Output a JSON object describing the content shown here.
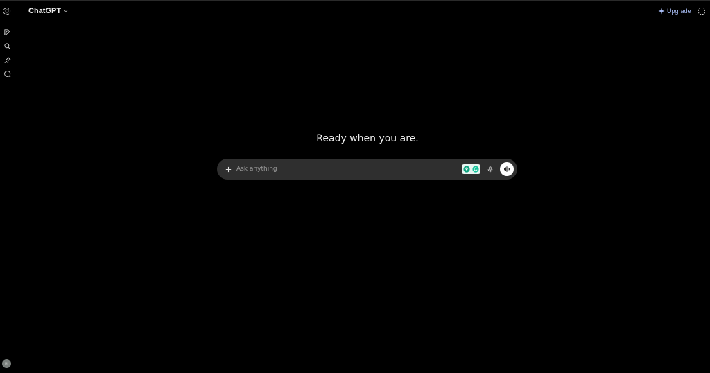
{
  "header": {
    "model_name": "ChatGPT",
    "upgrade_label": "Upgrade"
  },
  "sidebar": {
    "icons": [
      "chatgpt-logo-icon",
      "new-chat-icon",
      "search-icon",
      "pin-icon",
      "chat-bubble-icon"
    ],
    "avatar_initials": "MI"
  },
  "main": {
    "greeting": "Ready when you are."
  },
  "composer": {
    "placeholder": "Ask anything"
  },
  "colors": {
    "background": "#000000",
    "composer_bg": "#2f2f2f",
    "upgrade_text": "#a8bdf5",
    "text": "#ececec",
    "placeholder": "#9b9b9b"
  }
}
